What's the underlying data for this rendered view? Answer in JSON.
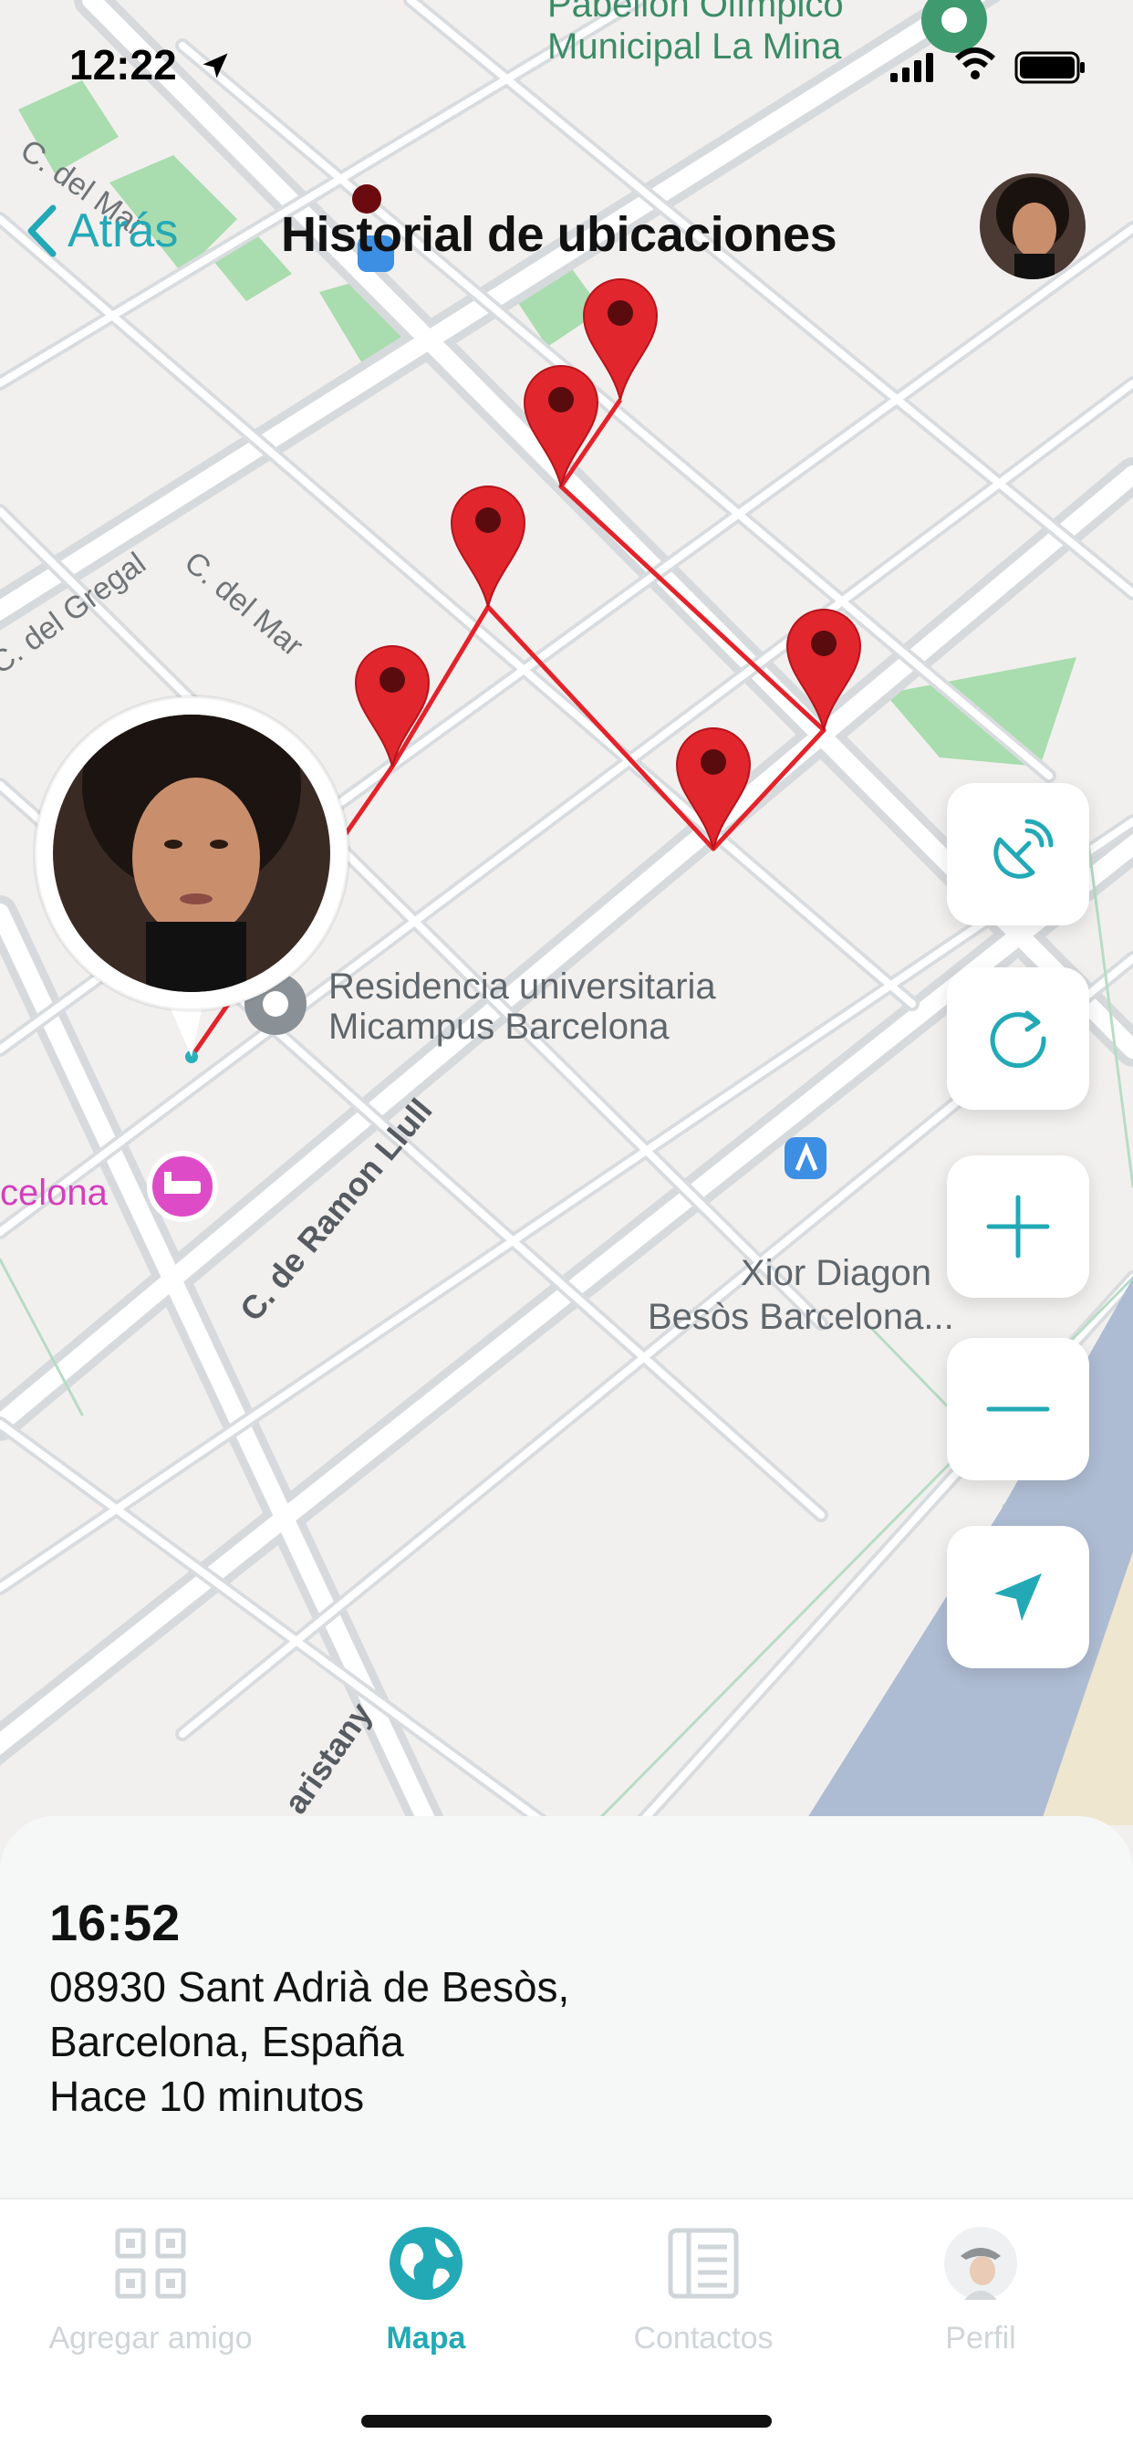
{
  "status_bar": {
    "time": "12:22"
  },
  "nav": {
    "back_label": "Atrás",
    "title": "Historial de ubicaciones"
  },
  "map": {
    "labels": {
      "place_top_line1": "Pabellón Olímpico",
      "place_top_line2": "Municipal La Mina",
      "street_del_mar_top": "C. del Mar",
      "street_del_gregal": "C. del Gregal",
      "street_del_mar": "C. del Mar",
      "poi_residencia_line1": "Residencia universitaria",
      "poi_residencia_line2": "Micampus Barcelona",
      "poi_hotel": "celona",
      "street_ramon_llull": "C. de Ramon Llull",
      "poi_xior_line1": "Xior Diagon",
      "poi_xior_line2": "Besòs Barcelona...",
      "street_maristany": "aristany"
    },
    "marker_count": 6
  },
  "controls": {
    "satellite": "satellite-dish-icon",
    "refresh": "refresh-icon",
    "zoom_in": "plus-icon",
    "zoom_out": "minus-icon",
    "locate": "location-arrow-icon"
  },
  "location_detail": {
    "time": "16:52",
    "address_line1": "08930 Sant Adrià de Besòs,",
    "address_line2": "Barcelona, España",
    "relative_time": "Hace 10 minutos"
  },
  "tabs": [
    {
      "label": "Agregar amigo",
      "icon": "qr-code-icon"
    },
    {
      "label": "Mapa",
      "icon": "globe-icon",
      "active": true
    },
    {
      "label": "Contactos",
      "icon": "contacts-book-icon"
    },
    {
      "label": "Perfil",
      "icon": "profile-avatar-icon"
    }
  ],
  "colors": {
    "accent": "#23a9b6",
    "route": "#e3232b",
    "marker": "#e1262d",
    "park": "#a9dcae"
  }
}
